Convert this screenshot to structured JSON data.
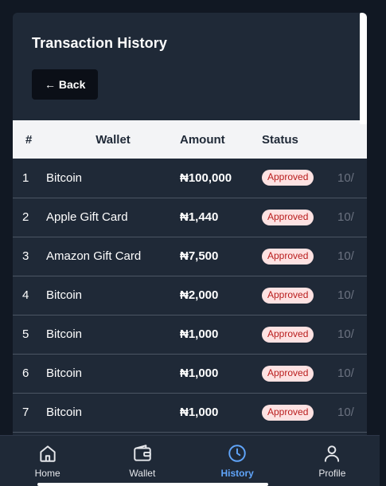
{
  "page_title": "Transaction History",
  "back_label": "← Back",
  "table": {
    "headers": {
      "num": "#",
      "wallet": "Wallet",
      "amount": "Amount",
      "status": "Status"
    },
    "rows": [
      {
        "num": "1",
        "wallet": "Bitcoin",
        "amount": "₦100,000",
        "status": "Approved",
        "date": "10/"
      },
      {
        "num": "2",
        "wallet": "Apple Gift Card",
        "amount": "₦1,440",
        "status": "Approved",
        "date": "10/"
      },
      {
        "num": "3",
        "wallet": "Amazon Gift Card",
        "amount": "₦7,500",
        "status": "Approved",
        "date": "10/"
      },
      {
        "num": "4",
        "wallet": "Bitcoin",
        "amount": "₦2,000",
        "status": "Approved",
        "date": "10/"
      },
      {
        "num": "5",
        "wallet": "Bitcoin",
        "amount": "₦1,000",
        "status": "Approved",
        "date": "10/"
      },
      {
        "num": "6",
        "wallet": "Bitcoin",
        "amount": "₦1,000",
        "status": "Approved",
        "date": "10/"
      },
      {
        "num": "7",
        "wallet": "Bitcoin",
        "amount": "₦1,000",
        "status": "Approved",
        "date": "10/"
      }
    ]
  },
  "nav": {
    "items": [
      {
        "label": "Home",
        "icon": "home-icon"
      },
      {
        "label": "Wallet",
        "icon": "wallet-icon"
      },
      {
        "label": "History",
        "icon": "clock-icon",
        "active": true
      },
      {
        "label": "Profile",
        "icon": "user-icon"
      }
    ]
  },
  "colors": {
    "accent": "#60a5fa",
    "badge_bg": "#fde2e2",
    "badge_text": "#b91c1c",
    "card": "#1f2937"
  }
}
